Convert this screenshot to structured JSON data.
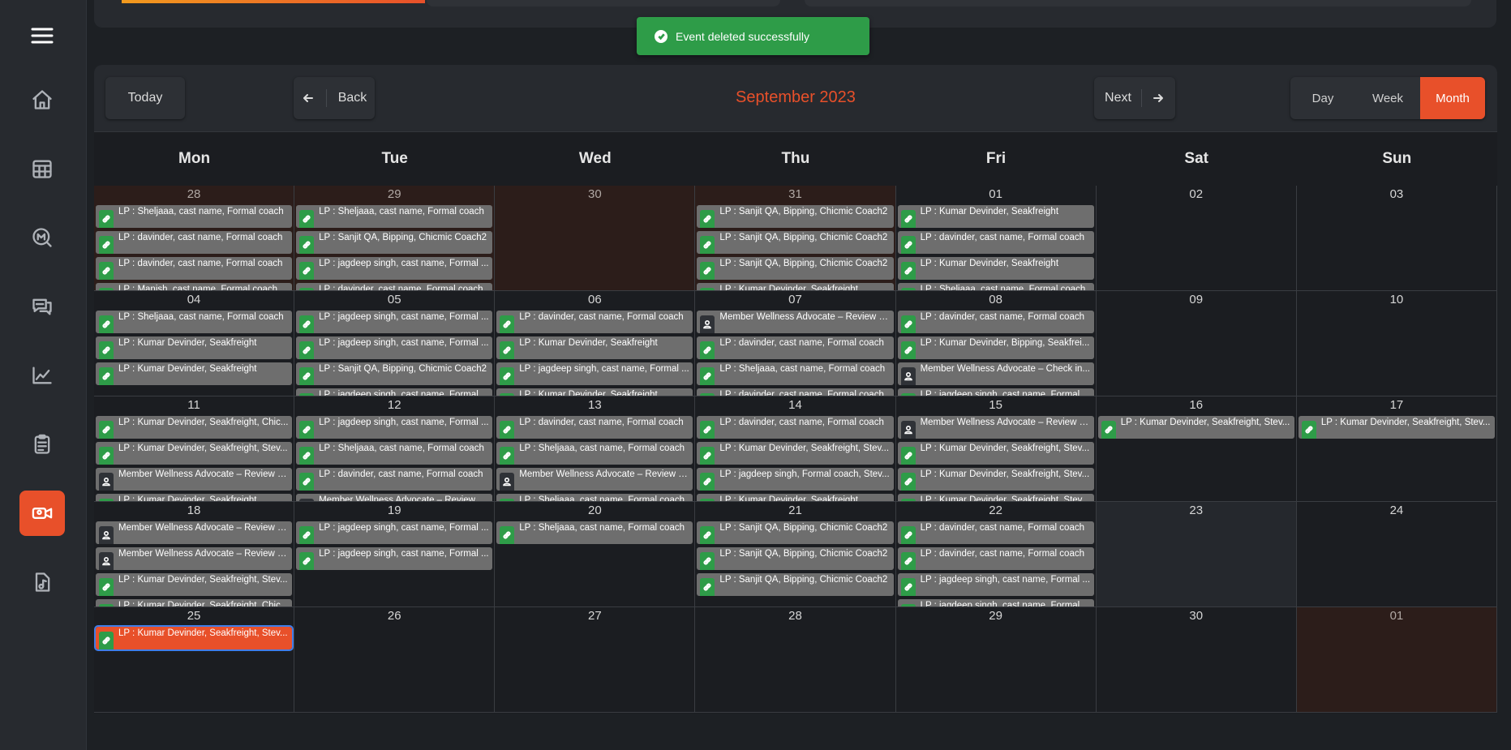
{
  "toast": {
    "message": "Event deleted successfully",
    "color": "#2e9c48"
  },
  "toolbar": {
    "today": "Today",
    "back": "Back",
    "next": "Next",
    "title": "September 2023",
    "views": [
      "Day",
      "Week",
      "Month"
    ],
    "active_view": "Month"
  },
  "sidebar": {
    "items": [
      "menu-icon",
      "home-icon",
      "calendar-grid-icon",
      "chat-m-icon",
      "messages-icon",
      "chart-icon",
      "clipboard-icon",
      "video-call-icon",
      "music-file-icon"
    ],
    "active": "video-call-icon"
  },
  "weekdays": [
    "Mon",
    "Tue",
    "Wed",
    "Thu",
    "Fri",
    "Sat",
    "Sun"
  ],
  "colors": {
    "accent": "#e8502a",
    "event": "#6e6e6e",
    "event_icon": "#2e9c48"
  },
  "weeks": [
    [
      {
        "n": "28",
        "off": true,
        "events": [
          {
            "t": "LP : Sheljaaa, cast name, Formal coach",
            "i": "link"
          },
          {
            "t": "LP : davinder, cast name, Formal coach",
            "i": "link"
          },
          {
            "t": "LP : davinder, cast name, Formal coach",
            "i": "link"
          },
          {
            "t": "LP : Manish, cast name, Formal coach",
            "i": "link"
          }
        ]
      },
      {
        "n": "29",
        "off": true,
        "events": [
          {
            "t": "LP : Sheljaaa, cast name, Formal coach",
            "i": "link"
          },
          {
            "t": "LP : Sanjit QA, Bipping, Chicmic Coach2",
            "i": "link"
          },
          {
            "t": "LP : jagdeep singh, cast name, Formal ...",
            "i": "link"
          },
          {
            "t": "LP : davinder, cast name, Formal coach",
            "i": "link"
          }
        ]
      },
      {
        "n": "30",
        "off": true,
        "events": []
      },
      {
        "n": "31",
        "off": true,
        "events": [
          {
            "t": "LP : Sanjit QA, Bipping, Chicmic Coach2",
            "i": "link"
          },
          {
            "t": "LP : Sanjit QA, Bipping, Chicmic Coach2",
            "i": "link"
          },
          {
            "t": "LP : Sanjit QA, Bipping, Chicmic Coach2",
            "i": "link"
          },
          {
            "t": "LP : Kumar Devinder, Seakfreight",
            "i": "link"
          }
        ]
      },
      {
        "n": "01",
        "events": [
          {
            "t": "LP : Kumar Devinder, Seakfreight",
            "i": "link"
          },
          {
            "t": "LP : davinder, cast name, Formal coach",
            "i": "link"
          },
          {
            "t": "LP : Kumar Devinder, Seakfreight",
            "i": "link"
          },
          {
            "t": "LP : Sheljaaa, cast name, Formal coach",
            "i": "link"
          }
        ]
      },
      {
        "n": "02",
        "events": []
      },
      {
        "n": "03",
        "events": []
      }
    ],
    [
      {
        "n": "04",
        "events": [
          {
            "t": "LP : Sheljaaa, cast name, Formal coach",
            "i": "link"
          },
          {
            "t": "LP : Kumar Devinder, Seakfreight",
            "i": "link"
          },
          {
            "t": "LP : Kumar Devinder, Seakfreight",
            "i": "link"
          }
        ]
      },
      {
        "n": "05",
        "events": [
          {
            "t": "LP : jagdeep singh, cast name, Formal ...",
            "i": "link"
          },
          {
            "t": "LP : jagdeep singh, cast name, Formal ...",
            "i": "link"
          },
          {
            "t": "LP : Sanjit QA, Bipping, Chicmic Coach2",
            "i": "link"
          },
          {
            "t": "LP : jagdeep singh, cast name, Formal ...",
            "i": "link"
          }
        ]
      },
      {
        "n": "06",
        "events": [
          {
            "t": "LP : davinder, cast name, Formal coach",
            "i": "link"
          },
          {
            "t": "LP : Kumar Devinder, Seakfreight",
            "i": "link"
          },
          {
            "t": "LP : jagdeep singh, cast name, Formal ...",
            "i": "link"
          },
          {
            "t": "LP : Kumar Devinder, Seakfreight",
            "i": "link"
          }
        ]
      },
      {
        "n": "07",
        "events": [
          {
            "t": "Member Wellness Advocate – Review : ...",
            "i": "person"
          },
          {
            "t": "LP : davinder, cast name, Formal coach",
            "i": "link"
          },
          {
            "t": "LP : Sheljaaa, cast name, Formal coach",
            "i": "link"
          },
          {
            "t": "LP : davinder, cast name, Formal coach",
            "i": "link"
          }
        ]
      },
      {
        "n": "08",
        "events": [
          {
            "t": "LP : davinder, cast name, Formal coach",
            "i": "link"
          },
          {
            "t": "LP : Kumar Devinder, Bipping, Seakfrei...",
            "i": "link"
          },
          {
            "t": "Member Wellness Advocate – Check in...",
            "i": "person"
          },
          {
            "t": "LP : jagdeep singh, cast name, Formal ...",
            "i": "link"
          }
        ]
      },
      {
        "n": "09",
        "events": []
      },
      {
        "n": "10",
        "events": []
      }
    ],
    [
      {
        "n": "11",
        "events": [
          {
            "t": "LP : Kumar Devinder, Seakfreight, Chic...",
            "i": "link"
          },
          {
            "t": "LP : Kumar Devinder, Seakfreight, Stev...",
            "i": "link"
          },
          {
            "t": "Member Wellness Advocate – Review : ...",
            "i": "person"
          },
          {
            "t": "LP : Kumar Devinder, Seakfreight",
            "i": "link"
          }
        ]
      },
      {
        "n": "12",
        "events": [
          {
            "t": "LP : jagdeep singh, cast name, Formal ...",
            "i": "link"
          },
          {
            "t": "LP : Sheljaaa, cast name, Formal coach",
            "i": "link"
          },
          {
            "t": "LP : davinder, cast name, Formal coach",
            "i": "link"
          },
          {
            "t": "Member Wellness Advocate – Review : ...",
            "i": "person"
          }
        ]
      },
      {
        "n": "13",
        "events": [
          {
            "t": "LP : davinder, cast name, Formal coach",
            "i": "link"
          },
          {
            "t": "LP : Sheljaaa, cast name, Formal coach",
            "i": "link"
          },
          {
            "t": "Member Wellness Advocate – Review : ...",
            "i": "person"
          },
          {
            "t": "LP : Sheljaaa, cast name, Formal coach",
            "i": "link"
          }
        ]
      },
      {
        "n": "14",
        "events": [
          {
            "t": "LP : davinder, cast name, Formal coach",
            "i": "link"
          },
          {
            "t": "LP : Kumar Devinder, Seakfreight, Stev...",
            "i": "link"
          },
          {
            "t": "LP : jagdeep singh, Formal coach, Stev...",
            "i": "link"
          },
          {
            "t": "LP : Kumar Devinder, Seakfreight",
            "i": "link"
          }
        ]
      },
      {
        "n": "15",
        "events": [
          {
            "t": "Member Wellness Advocate – Review : ...",
            "i": "person"
          },
          {
            "t": "LP : Kumar Devinder, Seakfreight, Stev...",
            "i": "link"
          },
          {
            "t": "LP : Kumar Devinder, Seakfreight, Stev...",
            "i": "link"
          },
          {
            "t": "LP : Kumar Devinder, Seakfreight, Stev...",
            "i": "link"
          }
        ]
      },
      {
        "n": "16",
        "events": [
          {
            "t": "LP : Kumar Devinder, Seakfreight, Stev...",
            "i": "link"
          }
        ]
      },
      {
        "n": "17",
        "events": [
          {
            "t": "LP : Kumar Devinder, Seakfreight, Stev...",
            "i": "link"
          }
        ]
      }
    ],
    [
      {
        "n": "18",
        "events": [
          {
            "t": "Member Wellness Advocate – Review : ...",
            "i": "person"
          },
          {
            "t": "Member Wellness Advocate – Review : ...",
            "i": "person"
          },
          {
            "t": "LP : Kumar Devinder, Seakfreight, Stev...",
            "i": "link"
          },
          {
            "t": "LP : Kumar Devinder, Seakfreight, Chic...",
            "i": "link"
          }
        ]
      },
      {
        "n": "19",
        "events": [
          {
            "t": "LP : jagdeep singh, cast name, Formal ...",
            "i": "link"
          },
          {
            "t": "LP : jagdeep singh, cast name, Formal ...",
            "i": "link"
          }
        ]
      },
      {
        "n": "20",
        "events": [
          {
            "t": "LP : Sheljaaa, cast name, Formal coach",
            "i": "link"
          }
        ]
      },
      {
        "n": "21",
        "events": [
          {
            "t": "LP : Sanjit QA, Bipping, Chicmic Coach2",
            "i": "link"
          },
          {
            "t": "LP : Sanjit QA, Bipping, Chicmic Coach2",
            "i": "link"
          },
          {
            "t": "LP : Sanjit QA, Bipping, Chicmic Coach2",
            "i": "link"
          }
        ]
      },
      {
        "n": "22",
        "events": [
          {
            "t": "LP : davinder, cast name, Formal coach",
            "i": "link"
          },
          {
            "t": "LP : davinder, cast name, Formal coach",
            "i": "link"
          },
          {
            "t": "LP : jagdeep singh, cast name, Formal ...",
            "i": "link"
          },
          {
            "t": "LP : jagdeep singh, cast name, Formal ...",
            "i": "link"
          }
        ]
      },
      {
        "n": "23",
        "shade": true,
        "events": []
      },
      {
        "n": "24",
        "events": []
      }
    ],
    [
      {
        "n": "25",
        "events": [
          {
            "t": "LP : Kumar Devinder, Seakfreight, Stev...",
            "i": "link",
            "sel": true
          }
        ]
      },
      {
        "n": "26",
        "events": []
      },
      {
        "n": "27",
        "events": []
      },
      {
        "n": "28",
        "events": []
      },
      {
        "n": "29",
        "events": []
      },
      {
        "n": "30",
        "events": []
      },
      {
        "n": "01",
        "off": true,
        "events": []
      }
    ]
  ]
}
